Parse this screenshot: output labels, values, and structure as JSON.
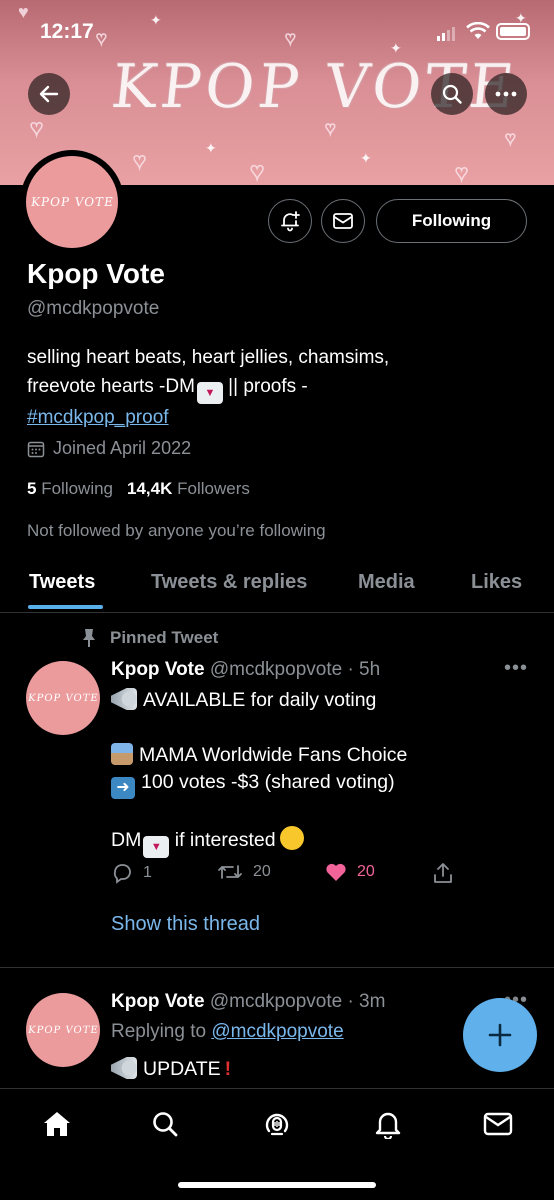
{
  "status_bar": {
    "time": "12:17"
  },
  "banner": {
    "title": "KPOP VOTE"
  },
  "profile": {
    "avatar_text": "KPOP VOTE",
    "name": "Kpop Vote",
    "handle": "@mcdkpopvote",
    "follow_button": "Following",
    "bio_line1": "selling heart beats, heart jellies, chamsims,",
    "bio_line2_a": "freevote hearts -DM",
    "bio_line2_b": " || proofs -",
    "bio_hashtag": "#mcdkpop_proof",
    "joined": "Joined April 2022",
    "following_count": "5",
    "following_label": "Following",
    "followers_count": "14,4K",
    "followers_label": "Followers",
    "not_followed": "Not followed by anyone you’re following"
  },
  "tabs": [
    {
      "label": "Tweets"
    },
    {
      "label": "Tweets & replies"
    },
    {
      "label": "Media"
    },
    {
      "label": "Likes"
    }
  ],
  "pinned_tweet": {
    "pinned_label": "Pinned Tweet",
    "author": "Kpop Vote",
    "meta": "@mcdkpopvote · 5h",
    "line1": "AVAILABLE for daily voting",
    "line2": "MAMA Worldwide Fans Choice",
    "line3": "100 votes -$3 (shared voting)",
    "line4": "DM",
    "line4_b": " if interested",
    "replies": "1",
    "retweets": "20",
    "likes": "20",
    "show_thread": "Show this thread"
  },
  "second_tweet": {
    "author": "Kpop Vote",
    "meta": "@mcdkpopvote · 3m",
    "replying_prefix": "Replying to ",
    "replying_handle": "@mcdkpopvote",
    "line1": "UPDATE"
  },
  "colors": {
    "accent": "#5ab0ea",
    "like": "#f2639a",
    "banner": "#e9a1a3"
  }
}
